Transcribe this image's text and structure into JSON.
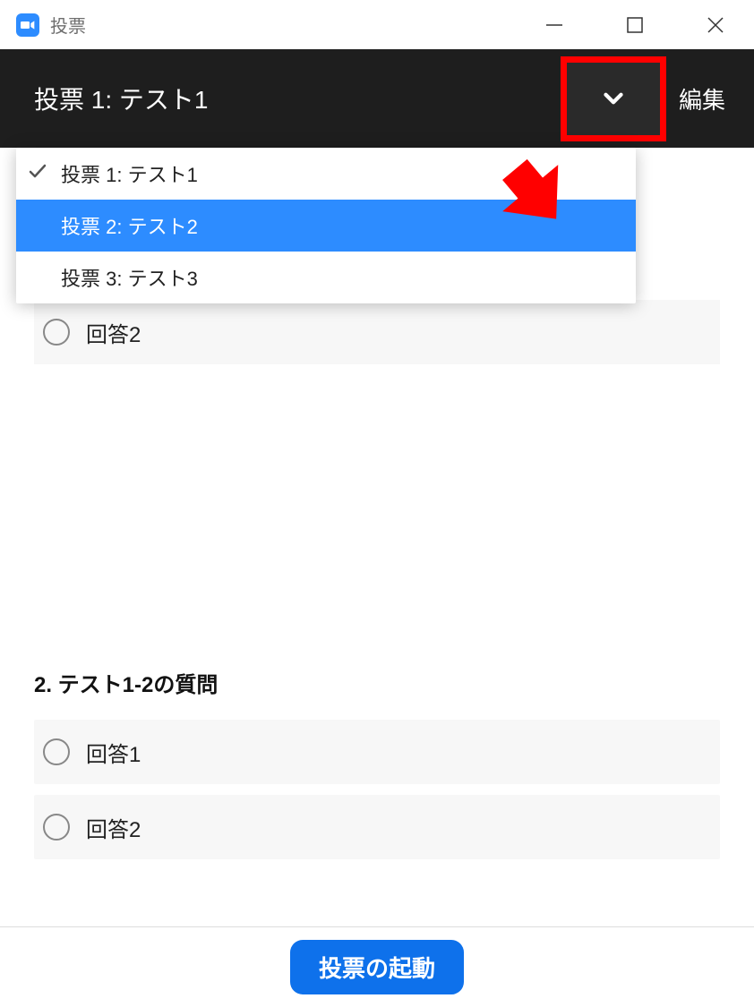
{
  "window": {
    "title": "投票"
  },
  "header": {
    "current_poll": "投票 1: テスト1",
    "edit_label": "編集"
  },
  "dropdown": {
    "items": [
      {
        "label": "投票 1: テスト1",
        "checked": true,
        "highlighted": false
      },
      {
        "label": "投票 2: テスト2",
        "checked": false,
        "highlighted": true
      },
      {
        "label": "投票 3: テスト3",
        "checked": false,
        "highlighted": false
      }
    ]
  },
  "visible_partial_answer": "回答2",
  "questions": [
    {
      "title": "2. テスト1-2の質問",
      "answers": [
        "回答1",
        "回答2"
      ]
    }
  ],
  "footer": {
    "launch_label": "投票の起動"
  },
  "colors": {
    "accent": "#2D8CFF",
    "highlight_red": "#ff0000",
    "primary_button": "#0E71EB"
  }
}
